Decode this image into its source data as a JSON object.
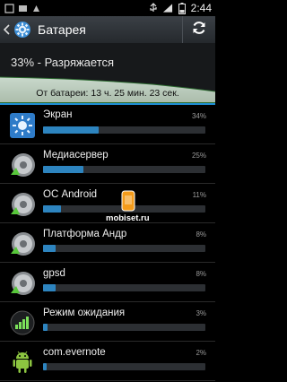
{
  "status_bar": {
    "time": "2:44",
    "left_icons": [
      "notification-icon",
      "notification-icon",
      "notification-icon"
    ],
    "right_icons": [
      "usb-icon",
      "signal-icon",
      "battery-icon"
    ]
  },
  "action_bar": {
    "title": "Батарея"
  },
  "battery": {
    "status": "33% - Разряжается",
    "graph_text": "От батареи: 13 ч. 25 мин. 23 сек.",
    "level": 0.33,
    "accent_color": "#1f8fd6"
  },
  "usage": [
    {
      "name": "Экран",
      "percent_label": "34%",
      "value": 34,
      "icon": "screen-icon"
    },
    {
      "name": "Медиасервер",
      "percent_label": "25%",
      "value": 25,
      "icon": "media-server-icon"
    },
    {
      "name": "ОС Android",
      "percent_label": "11%",
      "value": 11,
      "icon": "android-os-icon"
    },
    {
      "name": "Платформа Андр",
      "percent_label": "8%",
      "value": 8,
      "icon": "android-platform-icon"
    },
    {
      "name": "gpsd",
      "percent_label": "8%",
      "value": 8,
      "icon": "gpsd-icon"
    },
    {
      "name": "Режим ожидания",
      "percent_label": "3%",
      "value": 3,
      "icon": "standby-icon"
    },
    {
      "name": "com.evernote",
      "percent_label": "2%",
      "value": 2,
      "icon": "android-robot-icon"
    }
  ],
  "watermark": {
    "text": "mobiset.ru"
  },
  "colors": {
    "bar": "#2d84bf",
    "bar_track": "#2c2f33"
  }
}
